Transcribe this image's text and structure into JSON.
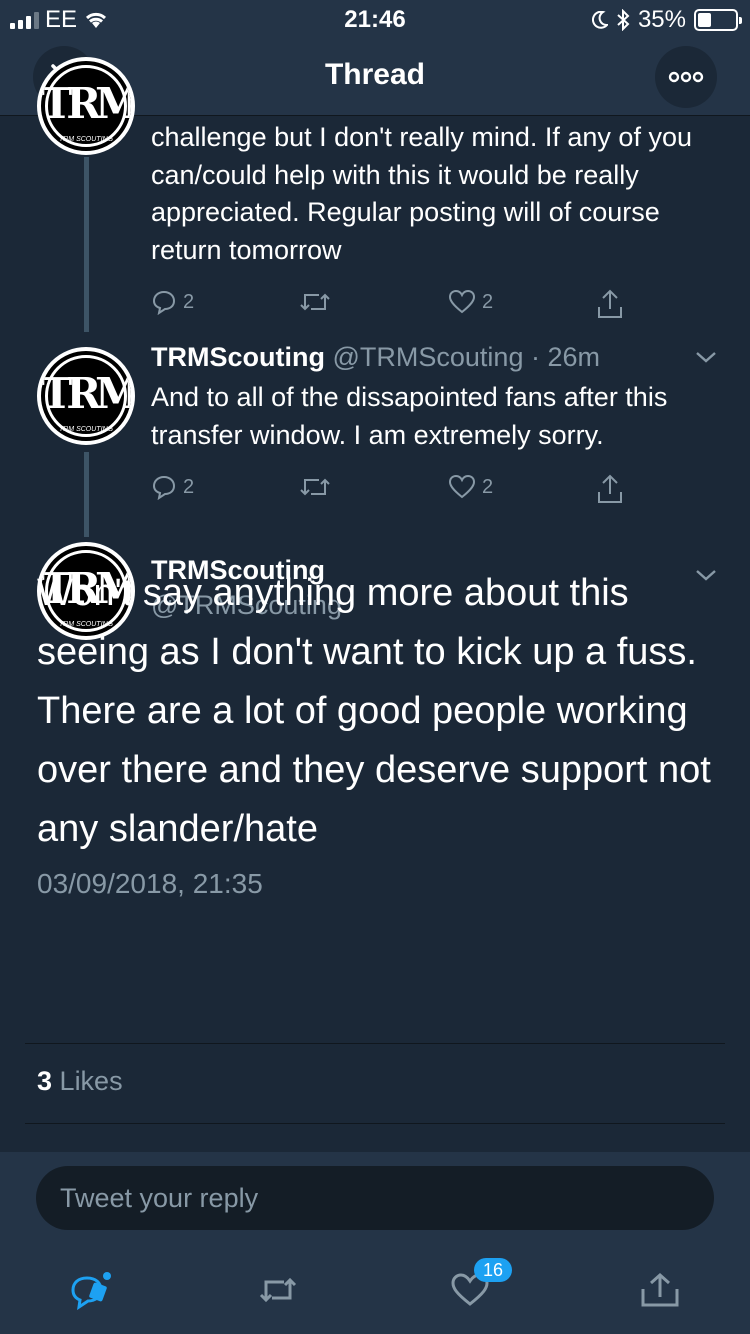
{
  "status_bar": {
    "carrier": "EE",
    "time": "21:46",
    "battery": "35%",
    "battery_level": 0.35
  },
  "nav": {
    "title": "Thread",
    "close_icon": "close-icon",
    "more_icon": "more-icon"
  },
  "tweets": [
    {
      "text": "challenge but I don't really mind. If any of you can/could help with this it would be really appreciated. Regular posting will of course return tomorrow",
      "replies": "2",
      "retweets": "",
      "likes": "2"
    },
    {
      "name": "TRMScouting",
      "handle": "@TRMScouting",
      "time": "· 26m",
      "text": "And to all of the dissapointed fans after this transfer window. I am extremely sorry.",
      "replies": "2",
      "retweets": "",
      "likes": "2"
    }
  ],
  "main_tweet": {
    "name": "TRMScouting",
    "handle": "@TRMScouting",
    "text": "Won't say anything more about this seeing as I don't want to kick up a fuss. There are a lot of good people working over there and they deserve support not any slander/hate",
    "timestamp": "03/09/2018, 21:35",
    "likes_count": "3",
    "likes_label": "Likes"
  },
  "avatar": {
    "monogram": "TRM",
    "caption": "TRM SCOUTING"
  },
  "reply": {
    "placeholder": "Tweet your reply"
  },
  "toolbar": {
    "notification_badge": "16"
  },
  "colors": {
    "background": "#1b2837",
    "bar": "#243447",
    "muted": "#8899a6",
    "accent": "#1da1f2"
  }
}
